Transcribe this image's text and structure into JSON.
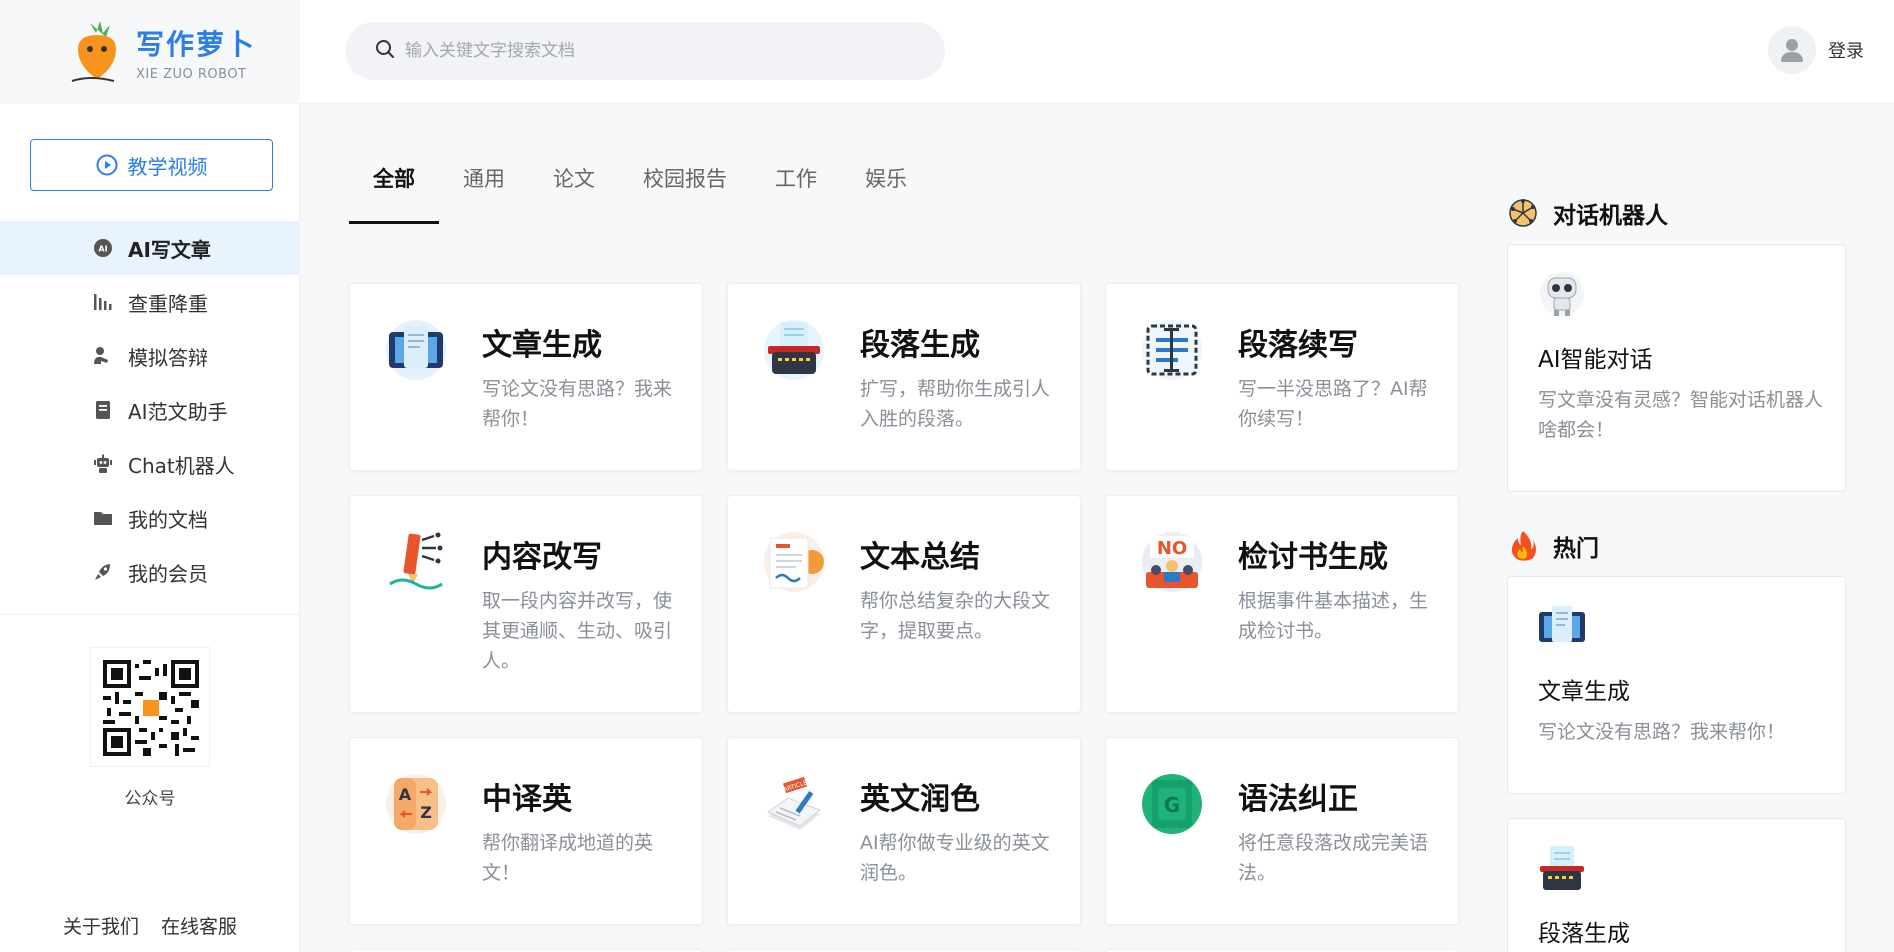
{
  "header": {
    "logo_cn": "写作萝卜",
    "logo_en": "XIE ZUO ROBOT",
    "search_placeholder": "输入关键文字搜索文档",
    "login_label": "登录"
  },
  "sidebar": {
    "video_button": "教学视频",
    "items": [
      {
        "label": "AI写文章",
        "icon": "ai-icon",
        "active": true
      },
      {
        "label": "查重降重",
        "icon": "chart-bars-icon",
        "active": false
      },
      {
        "label": "模拟答辩",
        "icon": "presenter-icon",
        "active": false
      },
      {
        "label": "AI范文助手",
        "icon": "book-icon",
        "active": false
      },
      {
        "label": "Chat机器人",
        "icon": "robot-icon",
        "active": false
      },
      {
        "label": "我的文档",
        "icon": "folder-icon",
        "active": false
      },
      {
        "label": "我的会员",
        "icon": "rocket-icon",
        "active": false
      }
    ],
    "qr_label": "公众号",
    "footer_links": [
      "关于我们",
      "在线客服"
    ]
  },
  "tabs": [
    "全部",
    "通用",
    "论文",
    "校园报告",
    "工作",
    "娱乐"
  ],
  "cards": [
    {
      "title": "文章生成",
      "desc": "写论文没有思路？我来帮你！",
      "icon": "monitor-document-icon"
    },
    {
      "title": "段落生成",
      "desc": "扩写，帮助你生成引人入胜的段落。",
      "icon": "typewriter-icon"
    },
    {
      "title": "段落续写",
      "desc": "写一半没思路了？AI帮你续写！",
      "icon": "text-cursor-icon"
    },
    {
      "title": "内容改写",
      "desc": "取一段内容并改写，使其更通顺、生动、吸引人。",
      "icon": "pencil-rewrite-icon"
    },
    {
      "title": "文本总结",
      "desc": "帮你总结复杂的大段文字，提取要点。",
      "icon": "summary-document-icon"
    },
    {
      "title": "检讨书生成",
      "desc": "根据事件基本描述，生成检讨书。",
      "icon": "no-sign-icon"
    },
    {
      "title": "中译英",
      "desc": "帮你翻译成地道的英文！",
      "icon": "translate-az-icon"
    },
    {
      "title": "英文润色",
      "desc": "AI帮你做专业级的英文润色。",
      "icon": "article-pen-icon"
    },
    {
      "title": "语法纠正",
      "desc": "将任意段落改成完美语法。",
      "icon": "grammar-book-icon"
    }
  ],
  "right_panel": {
    "chat_heading": "对话机器人",
    "chat_card": {
      "title": "AI智能对话",
      "desc": "写文章没有灵感？智能对话机器人啥都会！",
      "icon": "robot-icon"
    },
    "hot_heading": "热门",
    "hot_cards": [
      {
        "title": "文章生成",
        "desc": "写论文没有思路？我来帮你！",
        "icon": "monitor-document-icon"
      },
      {
        "title": "段落生成",
        "desc": "",
        "icon": "typewriter-icon"
      }
    ]
  },
  "colors": {
    "accent": "#2b7de9",
    "active_bg": "#e8f3fe",
    "text_muted": "#8a8f98"
  }
}
